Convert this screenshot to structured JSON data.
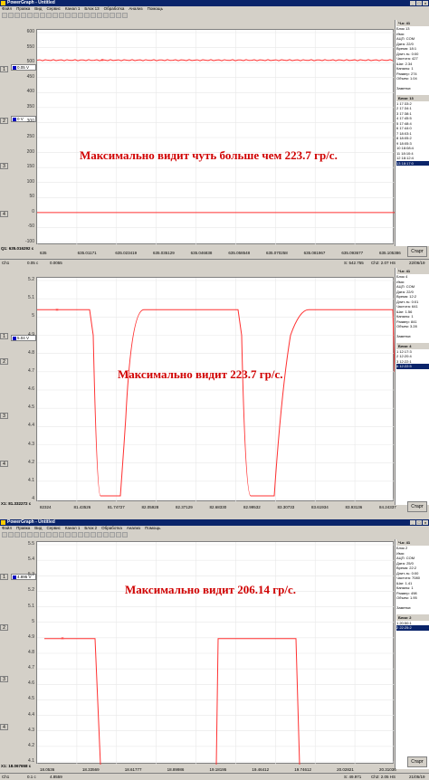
{
  "app": {
    "title": "PowerGraph - Untitled"
  },
  "menu": [
    "Файл",
    "Правка",
    "Вид",
    "Сервис",
    "Канал 1",
    "Блок 13",
    "Обработка",
    "Анализ",
    "Помощь"
  ],
  "menu2": [
    "Файл",
    "Правка",
    "Вид",
    "Сервис",
    "Канал 1",
    "Блок 2",
    "Обработка",
    "Анализ",
    "Помощь"
  ],
  "panels": [
    {
      "caption": "Максимально видит чуть больше чем 223.7 гр/с.",
      "y_ticks": [
        "600",
        "550",
        "500",
        "450",
        "400",
        "350",
        "300",
        "250",
        "200",
        "150",
        "100",
        "50",
        "0",
        "-50",
        "-100"
      ],
      "channel_value_a": "0.05 V",
      "channel_value_b": "0 V",
      "x_label": "Q1: 635.016292 c",
      "x_ticks": [
        "635",
        "635.01171",
        "635.023419",
        "635.035129",
        "635.046838",
        "635.058548",
        "635.070258",
        "635.081967",
        "635.093677",
        "635.105386"
      ],
      "status": {
        "ch": "Ch1",
        "a": "0.05 c",
        "b": "0.0055",
        "count": "S: 542.755",
        "t": "Ch2: 2.07 HS",
        "date": "22/06/19"
      },
      "side": {
        "channel": "Ч-к: 41",
        "fields": [
          "Блок 13",
          "Имя:",
          "АЦП: COM",
          "Дата: 22/0",
          "Время: 18:1",
          "Длит-ть: 0:00",
          "Частота: 427",
          "Шаг: 2.34",
          "Каналы: 1",
          "Размер: 274",
          "Объем: 1.04",
          "",
          "Заметки:"
        ],
        "list_head": "Блок: 13",
        "list": [
          "1  17:33:2",
          "2  17:34:1",
          "3  17:38:1",
          "4  17:45:5",
          "5  17:48:4",
          "6  17:44:0",
          "7  18:03:1",
          "8  18:05:2",
          "9  18:05:3",
          "10 18:08:4",
          "11 18:10:4",
          "12 18:12:4",
          "13 18:17:0"
        ]
      }
    },
    {
      "caption": "Максимально видит 223.7 гр/с.",
      "y_ticks": [
        "5.2",
        "5.1",
        "5",
        "4.9",
        "4.8",
        "4.7",
        "4.6",
        "4.5",
        "4.4",
        "4.3",
        "4.2",
        "4.1",
        "4"
      ],
      "channel_value_a": "5.04 V",
      "x_label": "X1: 81.332272 c",
      "x_ticks": [
        "82324",
        "81.43526",
        "81.74727",
        "82.05928",
        "82.37129",
        "82.68330",
        "82.99532",
        "83.30733",
        "83.61934",
        "83.93136",
        "84.24337"
      ],
      "side": {
        "channel": "Ч-к: 41",
        "fields": [
          "Блок 4",
          "Имя:",
          "АЦП: COM",
          "Дата: 22/0",
          "Время: 12:2",
          "Длит-ть: 0:01",
          "Частота: 641",
          "Шаг: 1.56",
          "Каналы: 1",
          "Размер: 841",
          "Объем: 3.28",
          "",
          "Заметки:"
        ],
        "list_head": "Блок: 4",
        "list": [
          "1  12:17:3",
          "2  12:20:4",
          "3  12:22:1",
          "4  12:22:5"
        ]
      }
    },
    {
      "caption": "Максимально видит 206.14 гр/с.",
      "y_ticks": [
        "5.5",
        "5.4",
        "5.3",
        "5.2",
        "5.1",
        "5",
        "4.9",
        "4.8",
        "4.7",
        "4.6",
        "4.5",
        "4.4",
        "4.3",
        "4.2",
        "4.1"
      ],
      "channel_value_a": "4.895 V",
      "x_label": "X1: 18.067658 c",
      "x_ticks": [
        "18.0536",
        "18.33569",
        "18.61777",
        "18.89986",
        "19.18195",
        "19.46412",
        "19.74612",
        "20.02821",
        "20.31036"
      ],
      "status": {
        "ch": "Ch1",
        "a": "0.1 c",
        "b": "4.8559",
        "count": "S: 49.971",
        "t": "Ch2: 2.05 HS",
        "date": "21/05/19"
      },
      "side": {
        "channel": "Ч-к: 41",
        "fields": [
          "Блок 2",
          "Имя:",
          "АЦП: COM",
          "Дата: 25/0",
          "Время: 22:2",
          "Длит-ть: 0:00",
          "Частота: 7080",
          "Шаг: 1.41",
          "Каналы: 1",
          "Размер: 498",
          "Объем: 1.95",
          "",
          "Заметки:"
        ],
        "list_head": "Блок: 2",
        "list": [
          "1  20:50:1",
          "2  22:25:2"
        ]
      }
    }
  ],
  "buttons": {
    "start": "Старт"
  },
  "colors": {
    "trace": "#ff3030",
    "titlebar": "#0a246a",
    "caption": "#d00000"
  },
  "chart_data": [
    {
      "type": "line",
      "series": [
        {
          "values": [
            508,
            508,
            508,
            508,
            508,
            508,
            508,
            508,
            508,
            508
          ]
        }
      ],
      "ylim": [
        -100,
        600
      ]
    },
    {
      "type": "line",
      "series": [
        {
          "values": [
            5.04,
            5.04,
            4.01,
            4.02,
            5.04,
            5.04,
            5.04,
            4.02,
            4.02,
            5.04,
            5.04
          ]
        }
      ],
      "ylim": [
        4.0,
        5.2
      ]
    },
    {
      "type": "line",
      "series": [
        {
          "values": [
            4.895,
            4.895,
            4.1,
            4.1,
            4.1,
            4.895,
            4.895,
            4.1,
            4.1
          ]
        }
      ],
      "ylim": [
        4.1,
        5.5
      ]
    }
  ]
}
